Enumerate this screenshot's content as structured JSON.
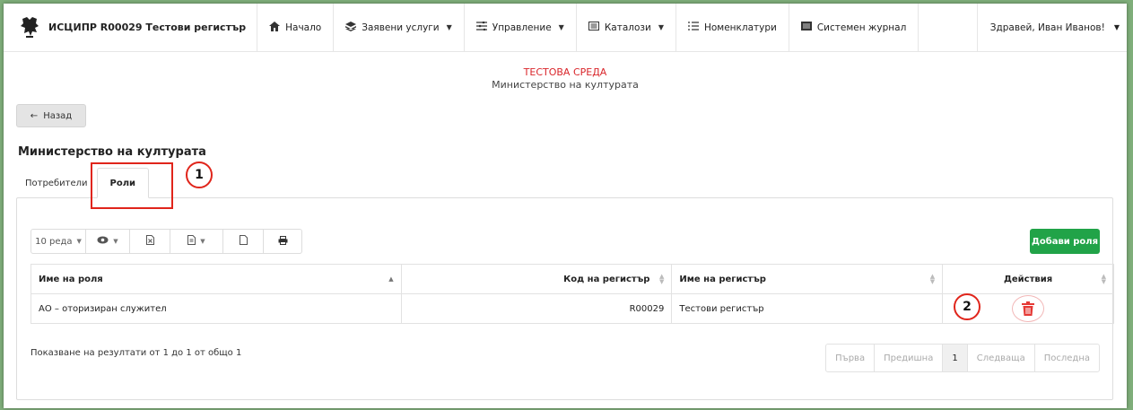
{
  "navbar": {
    "brand_title": "ИСЦИПР R00029 Тестови регистър",
    "items": [
      {
        "label": "Начало",
        "icon": "home-icon",
        "dropdown": false
      },
      {
        "label": "Заявени услуги",
        "icon": "stack-icon",
        "dropdown": true
      },
      {
        "label": "Управление",
        "icon": "sliders-icon",
        "dropdown": true
      },
      {
        "label": "Каталози",
        "icon": "list-box-icon",
        "dropdown": true
      },
      {
        "label": "Номенклатури",
        "icon": "list-icon",
        "dropdown": false
      },
      {
        "label": "Системен журнал",
        "icon": "journal-icon",
        "dropdown": false
      }
    ],
    "user_greeting": "Здравей, Иван Иванов!"
  },
  "env": {
    "name": "ТЕСТОВА СРЕДА",
    "org": "Министерство на културата"
  },
  "back_button_label": "Назад",
  "page_title": "Министерство на културата",
  "tabs": [
    {
      "label": "Потребители",
      "active": false
    },
    {
      "label": "Роли",
      "active": true
    }
  ],
  "toolbar": {
    "page_size_label": "10 реда"
  },
  "add_button_label": "Добави роля",
  "table": {
    "columns": [
      "Име на роля",
      "Код на регистър",
      "Име на регистър",
      "Действия"
    ],
    "rows": [
      {
        "role": "АО – оторизиран служител",
        "code": "R00029",
        "register": "Тестови регистър"
      }
    ]
  },
  "info_text": "Показване на резултати от 1 до 1 от общо 1",
  "pagination": {
    "first": "Първа",
    "prev": "Предишна",
    "current": "1",
    "next": "Следваща",
    "last": "Последна"
  },
  "annotations": {
    "marker_1": "1",
    "marker_2": "2"
  },
  "colors": {
    "accent_green": "#21a348",
    "env_red": "#d9262b",
    "marker_red": "#e0251b",
    "delete_red": "#e53935"
  }
}
